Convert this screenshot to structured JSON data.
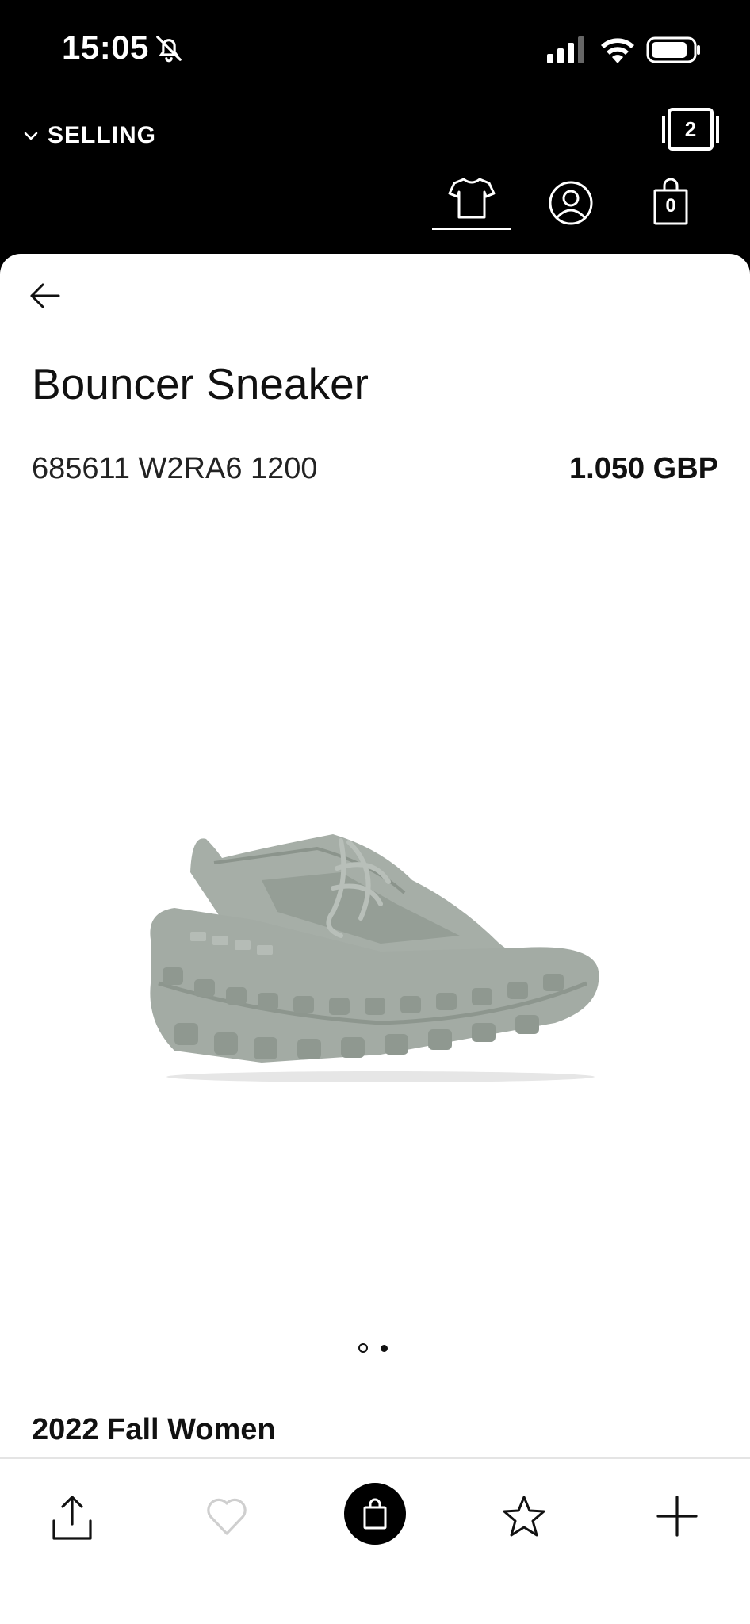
{
  "status_bar": {
    "time": "15:05"
  },
  "header": {
    "mode_label": "SELLING",
    "tabs_count": "2",
    "bag_count": "0"
  },
  "product": {
    "title": "Bouncer Sneaker",
    "sku": "685611 W2RA6 1200",
    "price": "1.050 GBP",
    "season": "2022 Fall Women",
    "image_count": 2,
    "image_index": 1
  },
  "colors": {
    "header_bg": "#000000",
    "sheet_bg": "#ffffff",
    "shoe_gray": "#9aa39b"
  }
}
